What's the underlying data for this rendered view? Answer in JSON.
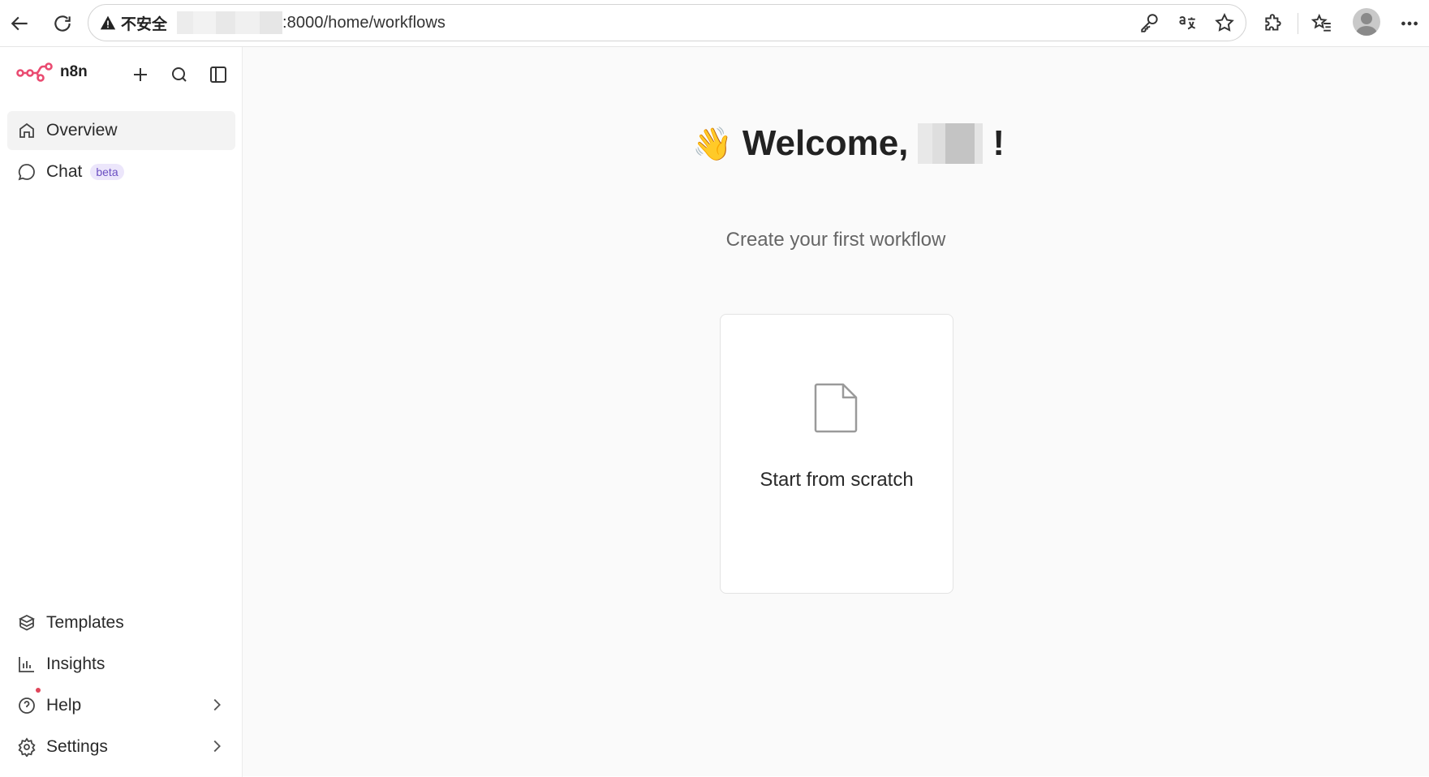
{
  "browser": {
    "security_label": "不安全",
    "url_suffix": ":8000/home/workflows",
    "icons": [
      "back-icon",
      "refresh-icon",
      "warning-icon",
      "key-icon",
      "translate-icon",
      "star-icon",
      "extensions-icon",
      "favorites-icon",
      "profile-avatar",
      "more-icon"
    ]
  },
  "sidebar": {
    "brand": "n8n",
    "brand_color": "#ea4b71",
    "items": [
      {
        "label": "Overview",
        "icon": "home-icon",
        "active": true
      },
      {
        "label": "Chat",
        "icon": "chat-icon",
        "badge": "beta"
      }
    ],
    "bottom_items": [
      {
        "label": "Templates",
        "icon": "templates-icon"
      },
      {
        "label": "Insights",
        "icon": "insights-icon"
      },
      {
        "label": "Help",
        "icon": "help-icon"
      },
      {
        "label": "Settings",
        "icon": "settings-icon"
      }
    ]
  },
  "main": {
    "welcome_prefix": "Welcome, ",
    "welcome_suffix": "!",
    "wave": "👋",
    "subtitle": "Create your first workflow",
    "card_label": "Start from scratch"
  }
}
